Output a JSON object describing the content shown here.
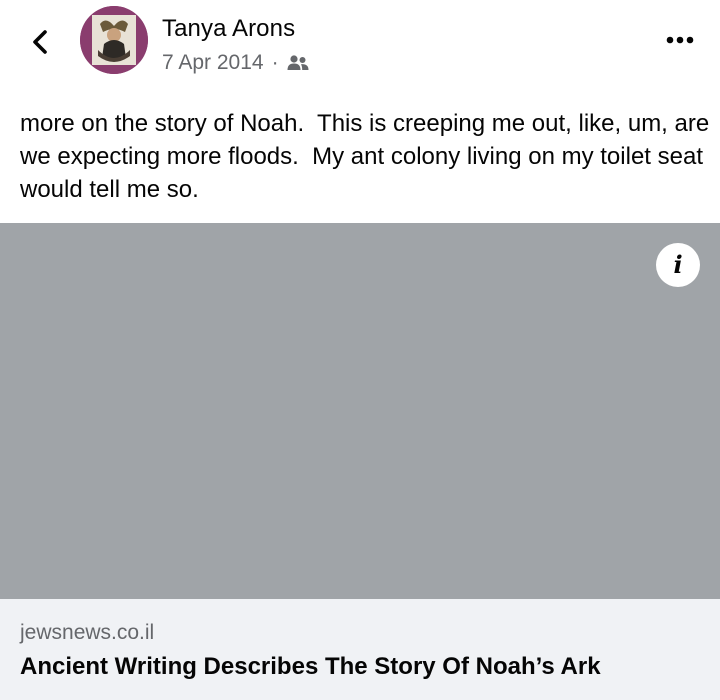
{
  "post": {
    "author": "Tanya Arons",
    "date": "7 Apr 2014",
    "separator": "·",
    "audience_icon": "friends-icon",
    "text": "more on the story of Noah.  This is creeping me out, like, um, are we expecting more floods.  My ant colony living on my toilet seat would tell me so."
  },
  "header": {
    "back_icon": "chevron-left-icon",
    "more_icon": "more-horizontal-icon"
  },
  "link_preview": {
    "domain": "jewsnews.co.il",
    "title": "Ancient Writing Describes The Story Of Noah’s Ark",
    "info_glyph": "i"
  },
  "colors": {
    "image_placeholder": "#a0a4a8",
    "footer_bg": "#f0f2f5",
    "secondary_text": "#65676b",
    "avatar_bg": "#8a3d6e"
  }
}
